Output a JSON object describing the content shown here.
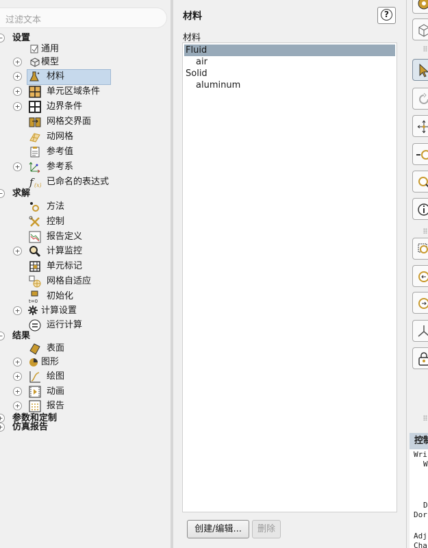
{
  "filter": {
    "placeholder": "过滤文本"
  },
  "tree": {
    "setup": {
      "label": "设置",
      "items": [
        "通用",
        "模型",
        "材料",
        "单元区域条件",
        "边界条件",
        "网格交界面",
        "动网格",
        "参考值",
        "参考系",
        "已命名的表达式"
      ]
    },
    "solution": {
      "label": "求解",
      "items": [
        "方法",
        "控制",
        "报告定义",
        "计算监控",
        "单元标记",
        "网格自适应",
        "初始化",
        "计算设置",
        "运行计算"
      ]
    },
    "results": {
      "label": "结果",
      "items": [
        "表面",
        "图形",
        "绘图",
        "动画",
        "报告"
      ]
    },
    "parametric": {
      "label": "参数和定制"
    },
    "simreport": {
      "label": "仿真报告"
    },
    "expander_plus": "+",
    "expander_minus": "−",
    "init_icon_text": "t=0"
  },
  "panel": {
    "title": "材料",
    "help": "?",
    "list_label": "材料",
    "materials": [
      {
        "name": "Fluid",
        "level": 0,
        "selected": true
      },
      {
        "name": "air",
        "level": 1,
        "selected": false
      },
      {
        "name": "Solid",
        "level": 0,
        "selected": false
      },
      {
        "name": "aluminum",
        "level": 1,
        "selected": false
      }
    ],
    "create_button": "创建/编辑...",
    "delete_button": "删除"
  },
  "console": {
    "title": "控制",
    "lines": [
      "Wri",
      "W",
      "D",
      "Dor",
      "Adj",
      "Cha"
    ]
  },
  "colors": {
    "selection": "#98aab9",
    "tree_selection": "#c6d9ec",
    "accent_gold": "#c99a2e"
  }
}
